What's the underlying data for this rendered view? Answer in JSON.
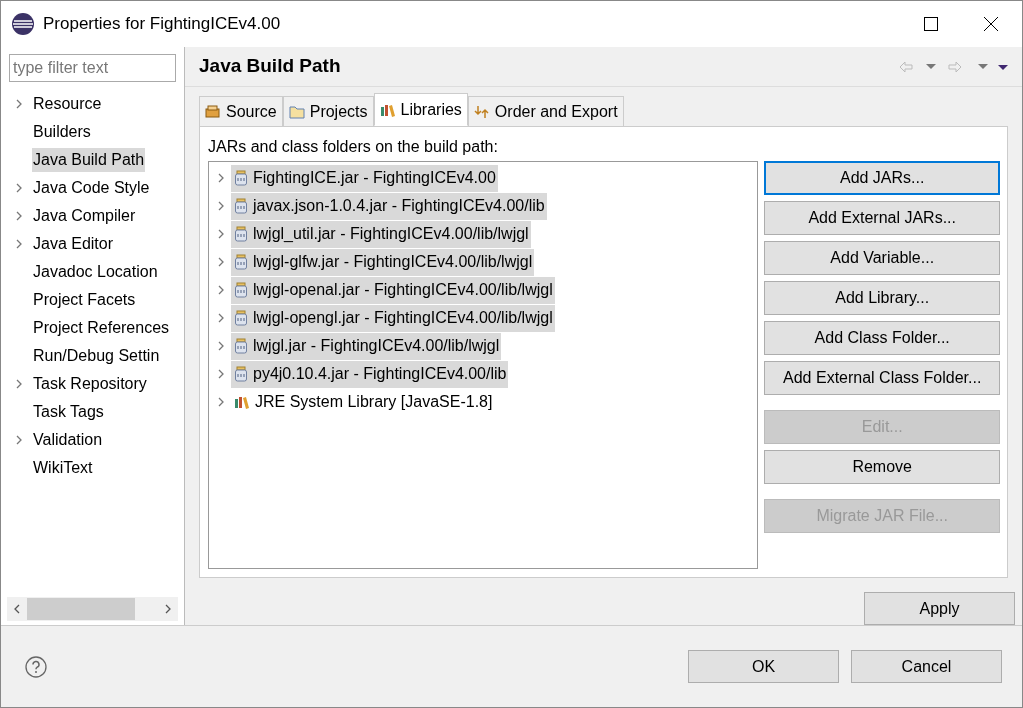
{
  "window": {
    "title": "Properties for FightingICEv4.00"
  },
  "sidebar": {
    "filter": {
      "placeholder": "type filter text"
    },
    "items": [
      {
        "label": "Resource",
        "expandable": true,
        "selected": false
      },
      {
        "label": "Builders",
        "expandable": false,
        "selected": false
      },
      {
        "label": "Java Build Path",
        "expandable": false,
        "selected": true
      },
      {
        "label": "Java Code Style",
        "expandable": true,
        "selected": false
      },
      {
        "label": "Java Compiler",
        "expandable": true,
        "selected": false
      },
      {
        "label": "Java Editor",
        "expandable": true,
        "selected": false
      },
      {
        "label": "Javadoc Location",
        "expandable": false,
        "selected": false
      },
      {
        "label": "Project Facets",
        "expandable": false,
        "selected": false
      },
      {
        "label": "Project References",
        "expandable": false,
        "selected": false
      },
      {
        "label": "Run/Debug Settin",
        "expandable": false,
        "selected": false
      },
      {
        "label": "Task Repository",
        "expandable": true,
        "selected": false
      },
      {
        "label": "Task Tags",
        "expandable": false,
        "selected": false
      },
      {
        "label": "Validation",
        "expandable": true,
        "selected": false
      },
      {
        "label": "WikiText",
        "expandable": false,
        "selected": false
      }
    ]
  },
  "page": {
    "title": "Java Build Path",
    "tabs": [
      {
        "label": "Source",
        "kind": "source",
        "selected": false
      },
      {
        "label": "Projects",
        "kind": "projects",
        "selected": false
      },
      {
        "label": "Libraries",
        "kind": "libraries",
        "selected": true
      },
      {
        "label": "Order and Export",
        "kind": "order",
        "selected": false
      }
    ],
    "caption": "JARs and class folders on the build path:",
    "entries": [
      {
        "label": "FightingICE.jar - FightingICEv4.00",
        "kind": "jar",
        "selected": true
      },
      {
        "label": "javax.json-1.0.4.jar - FightingICEv4.00/lib",
        "kind": "jar",
        "selected": true
      },
      {
        "label": "lwjgl_util.jar - FightingICEv4.00/lib/lwjgl",
        "kind": "jar",
        "selected": true
      },
      {
        "label": "lwjgl-glfw.jar - FightingICEv4.00/lib/lwjgl",
        "kind": "jar",
        "selected": true
      },
      {
        "label": "lwjgl-openal.jar - FightingICEv4.00/lib/lwjgl",
        "kind": "jar",
        "selected": true
      },
      {
        "label": "lwjgl-opengl.jar - FightingICEv4.00/lib/lwjgl",
        "kind": "jar",
        "selected": true
      },
      {
        "label": "lwjgl.jar - FightingICEv4.00/lib/lwjgl",
        "kind": "jar",
        "selected": true
      },
      {
        "label": "py4j0.10.4.jar - FightingICEv4.00/lib",
        "kind": "jar",
        "selected": true
      },
      {
        "label": "JRE System Library [JavaSE-1.8]",
        "kind": "library",
        "selected": false
      }
    ],
    "button_groups": [
      [
        {
          "label": "Add JARs...",
          "disabled": false,
          "focused": true
        },
        {
          "label": "Add External JARs...",
          "disabled": false,
          "focused": false
        },
        {
          "label": "Add Variable...",
          "disabled": false,
          "focused": false
        },
        {
          "label": "Add Library...",
          "disabled": false,
          "focused": false
        },
        {
          "label": "Add Class Folder...",
          "disabled": false,
          "focused": false
        },
        {
          "label": "Add External Class Folder...",
          "disabled": false,
          "focused": false
        }
      ],
      [
        {
          "label": "Edit...",
          "disabled": true,
          "focused": false
        },
        {
          "label": "Remove",
          "disabled": false,
          "focused": false
        }
      ],
      [
        {
          "label": "Migrate JAR File...",
          "disabled": true,
          "focused": false
        }
      ]
    ],
    "apply": "Apply"
  },
  "footer": {
    "buttons": [
      "OK",
      "Cancel"
    ]
  }
}
